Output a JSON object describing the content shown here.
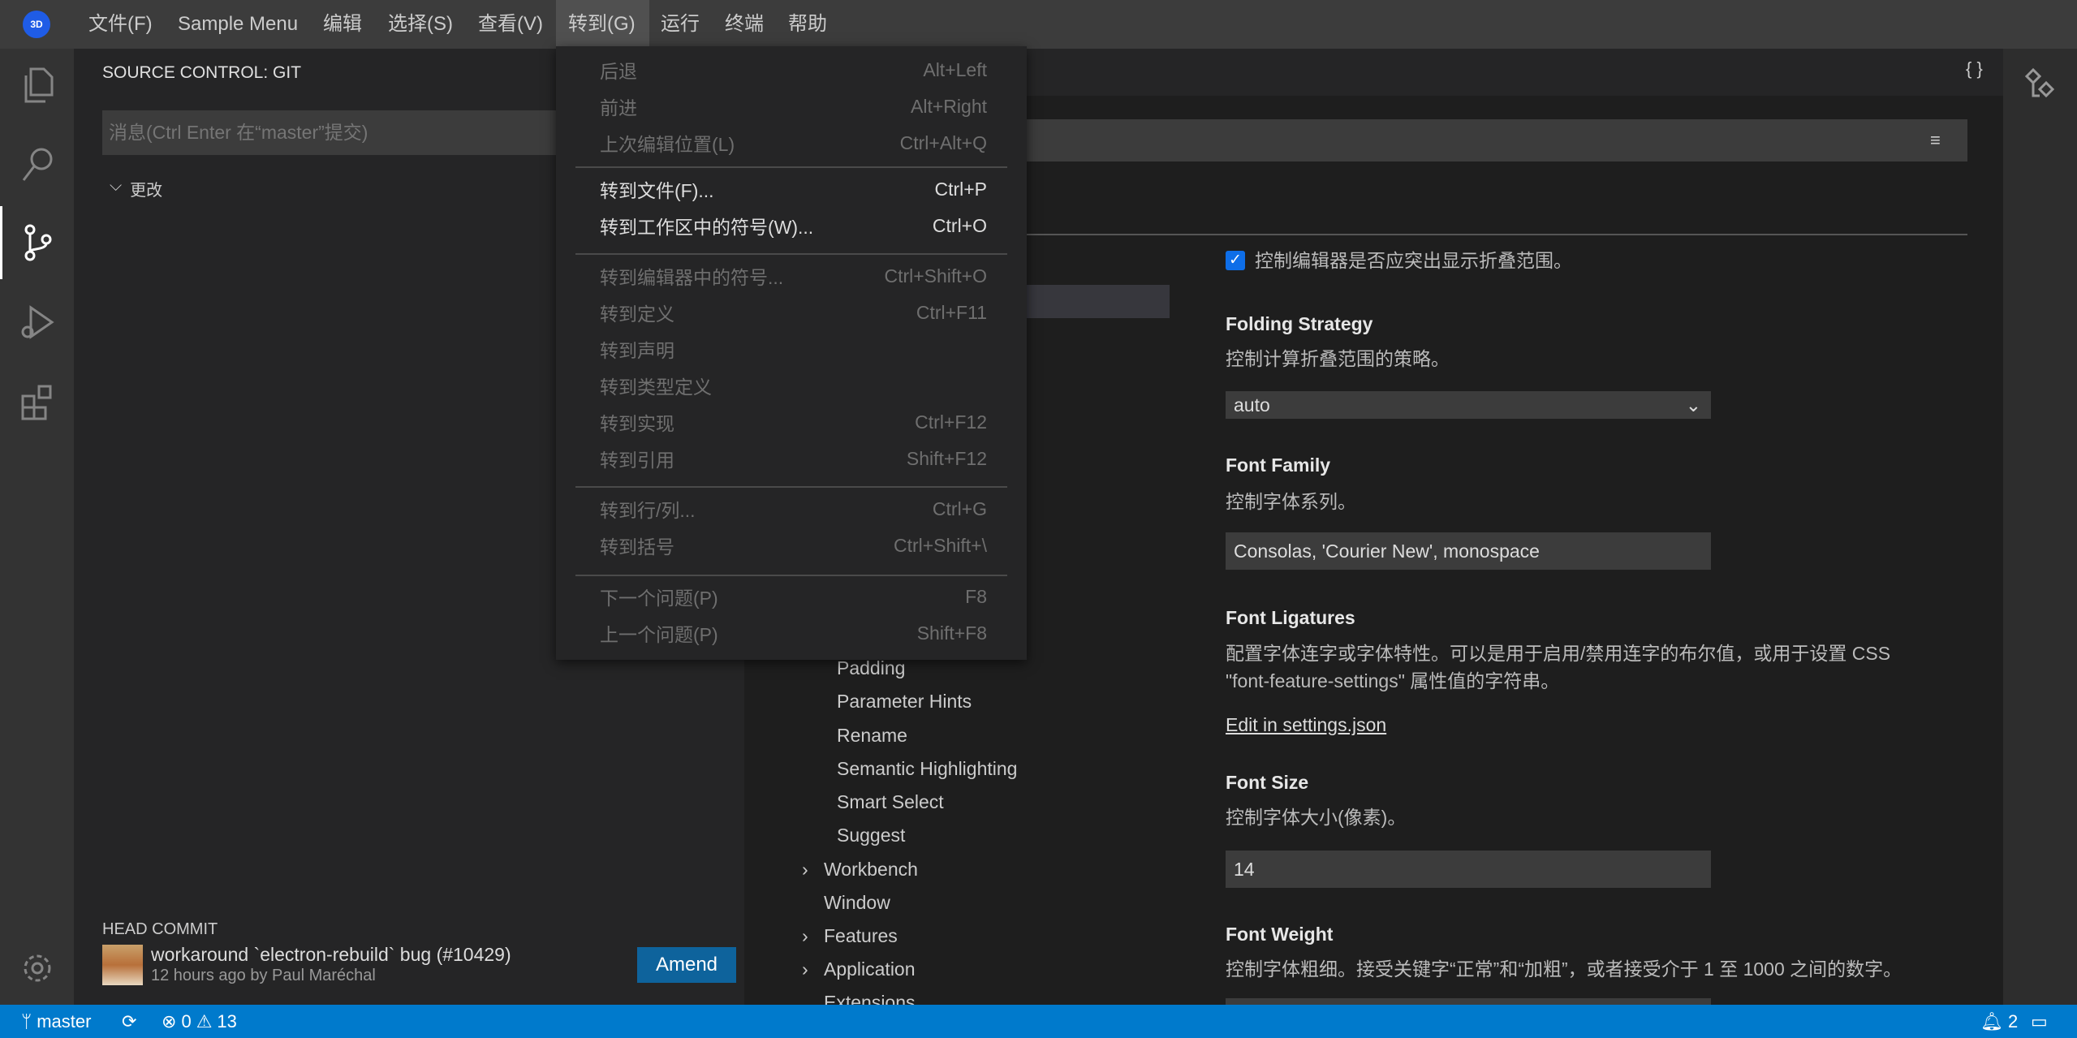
{
  "menubar": {
    "items": [
      "文件(F)",
      "Sample Menu",
      "编辑",
      "选择(S)",
      "查看(V)",
      "转到(G)",
      "运行",
      "终端",
      "帮助"
    ],
    "active": "转到(G)"
  },
  "goto_menu": {
    "items": [
      {
        "label": "后退",
        "shortcut": "Alt+Left",
        "enabled": false
      },
      {
        "label": "前进",
        "shortcut": "Alt+Right",
        "enabled": false
      },
      {
        "label": "上次编辑位置(L)",
        "shortcut": "Ctrl+Alt+Q",
        "enabled": false
      },
      {
        "label": "转到文件(F)...",
        "shortcut": "Ctrl+P",
        "enabled": true
      },
      {
        "label": "转到工作区中的符号(W)...",
        "shortcut": "Ctrl+O",
        "enabled": true
      },
      {
        "label": "转到编辑器中的符号...",
        "shortcut": "Ctrl+Shift+O",
        "enabled": false
      },
      {
        "label": "转到定义",
        "shortcut": "Ctrl+F11",
        "enabled": false
      },
      {
        "label": "转到声明",
        "shortcut": "",
        "enabled": false
      },
      {
        "label": "转到类型定义",
        "shortcut": "",
        "enabled": false
      },
      {
        "label": "转到实现",
        "shortcut": "Ctrl+F12",
        "enabled": false
      },
      {
        "label": "转到引用",
        "shortcut": "Shift+F12",
        "enabled": false
      },
      {
        "label": "转到行/列...",
        "shortcut": "Ctrl+G",
        "enabled": false
      },
      {
        "label": "转到括号",
        "shortcut": "Ctrl+Shift+\\",
        "enabled": false
      },
      {
        "label": "下一个问题(P)",
        "shortcut": "F8",
        "enabled": false
      },
      {
        "label": "上一个问题(P)",
        "shortcut": "Shift+F8",
        "enabled": false
      }
    ]
  },
  "sidebar": {
    "title": "SOURCE CONTROL: GIT",
    "message_placeholder": "消息(Ctrl Enter 在“master”提交)",
    "changes_label": "更改",
    "head_commit": {
      "heading": "HEAD COMMIT",
      "message": "workaround `electron-rebuild` bug (#10429)",
      "meta": "12 hours ago by Paul Maréchal",
      "amend_label": "Amend"
    }
  },
  "editor": {
    "json_button": "{ }"
  },
  "settings": {
    "tree": {
      "subitems": [
        "Padding",
        "Parameter Hints",
        "Rename",
        "Semantic Highlighting",
        "Smart Select",
        "Suggest"
      ],
      "groups": [
        {
          "label": "Workbench",
          "collapsible": true
        },
        {
          "label": "Window",
          "collapsible": false
        },
        {
          "label": "Features",
          "collapsible": true
        },
        {
          "label": "Application",
          "collapsible": true
        },
        {
          "label": "Extensions",
          "collapsible": true
        }
      ]
    },
    "folding_highlight": {
      "desc": "控制编辑器是否应突出显示折叠范围。",
      "checked": true
    },
    "folding_strategy": {
      "title": "Folding Strategy",
      "desc": "控制计算折叠范围的策略。",
      "value": "auto"
    },
    "font_family": {
      "title": "Font Family",
      "desc": "控制字体系列。",
      "value": "Consolas, 'Courier New', monospace"
    },
    "font_ligatures": {
      "title": "Font Ligatures",
      "desc1": "配置字体连字或字体特性。可以是用于启用/禁用连字的布尔值，或用于设置 CSS",
      "desc2": "\"font-feature-settings\" 属性值的字符串。",
      "link": "Edit in settings.json"
    },
    "font_size": {
      "title": "Font Size",
      "desc": "控制字体大小(像素)。",
      "value": "14"
    },
    "font_weight": {
      "title": "Font Weight",
      "desc": "控制字体粗细。接受关键字“正常”和“加粗”，或者接受介于 1 至 1000 之间的数字。"
    }
  },
  "statusbar": {
    "branch": "master",
    "errors": "0",
    "warnings": "13",
    "notifications": "2"
  },
  "colors": {
    "accent": "#007acc",
    "checkbox": "#0e6ee8",
    "amend": "#0e639c"
  }
}
